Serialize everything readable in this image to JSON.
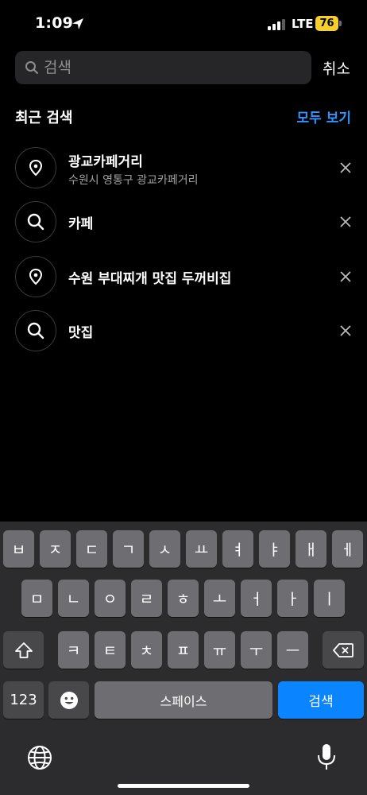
{
  "status": {
    "time": "1:09",
    "network": "LTE",
    "battery": "76"
  },
  "search": {
    "placeholder": "검색",
    "cancel_label": "취소"
  },
  "recent": {
    "title": "최근 검색",
    "see_all_label": "모두 보기",
    "items": [
      {
        "icon": "location-pin-icon",
        "title": "광교카페거리",
        "subtitle": "수원시 영통구 광교카페거리"
      },
      {
        "icon": "search-icon",
        "title": "카페"
      },
      {
        "icon": "location-pin-icon",
        "title": "수원 부대찌개 맛집 두꺼비집"
      },
      {
        "icon": "search-icon",
        "title": "맛집"
      }
    ]
  },
  "keyboard": {
    "row1": [
      "ㅂ",
      "ㅈ",
      "ㄷ",
      "ㄱ",
      "ㅅ",
      "ㅛ",
      "ㅕ",
      "ㅑ",
      "ㅐ",
      "ㅔ"
    ],
    "row2": [
      "ㅁ",
      "ㄴ",
      "ㅇ",
      "ㄹ",
      "ㅎ",
      "ㅗ",
      "ㅓ",
      "ㅏ",
      "ㅣ"
    ],
    "row3": [
      "ㅋ",
      "ㅌ",
      "ㅊ",
      "ㅍ",
      "ㅠ",
      "ㅜ",
      "ㅡ"
    ],
    "numbers_label": "123",
    "space_label": "스페이스",
    "return_label": "검색"
  },
  "colors": {
    "accent": "#2f94ff",
    "return_key": "#0a84ff",
    "battery": "#f5d02b",
    "background": "#000000",
    "keyboard": "#2c2c2e"
  }
}
